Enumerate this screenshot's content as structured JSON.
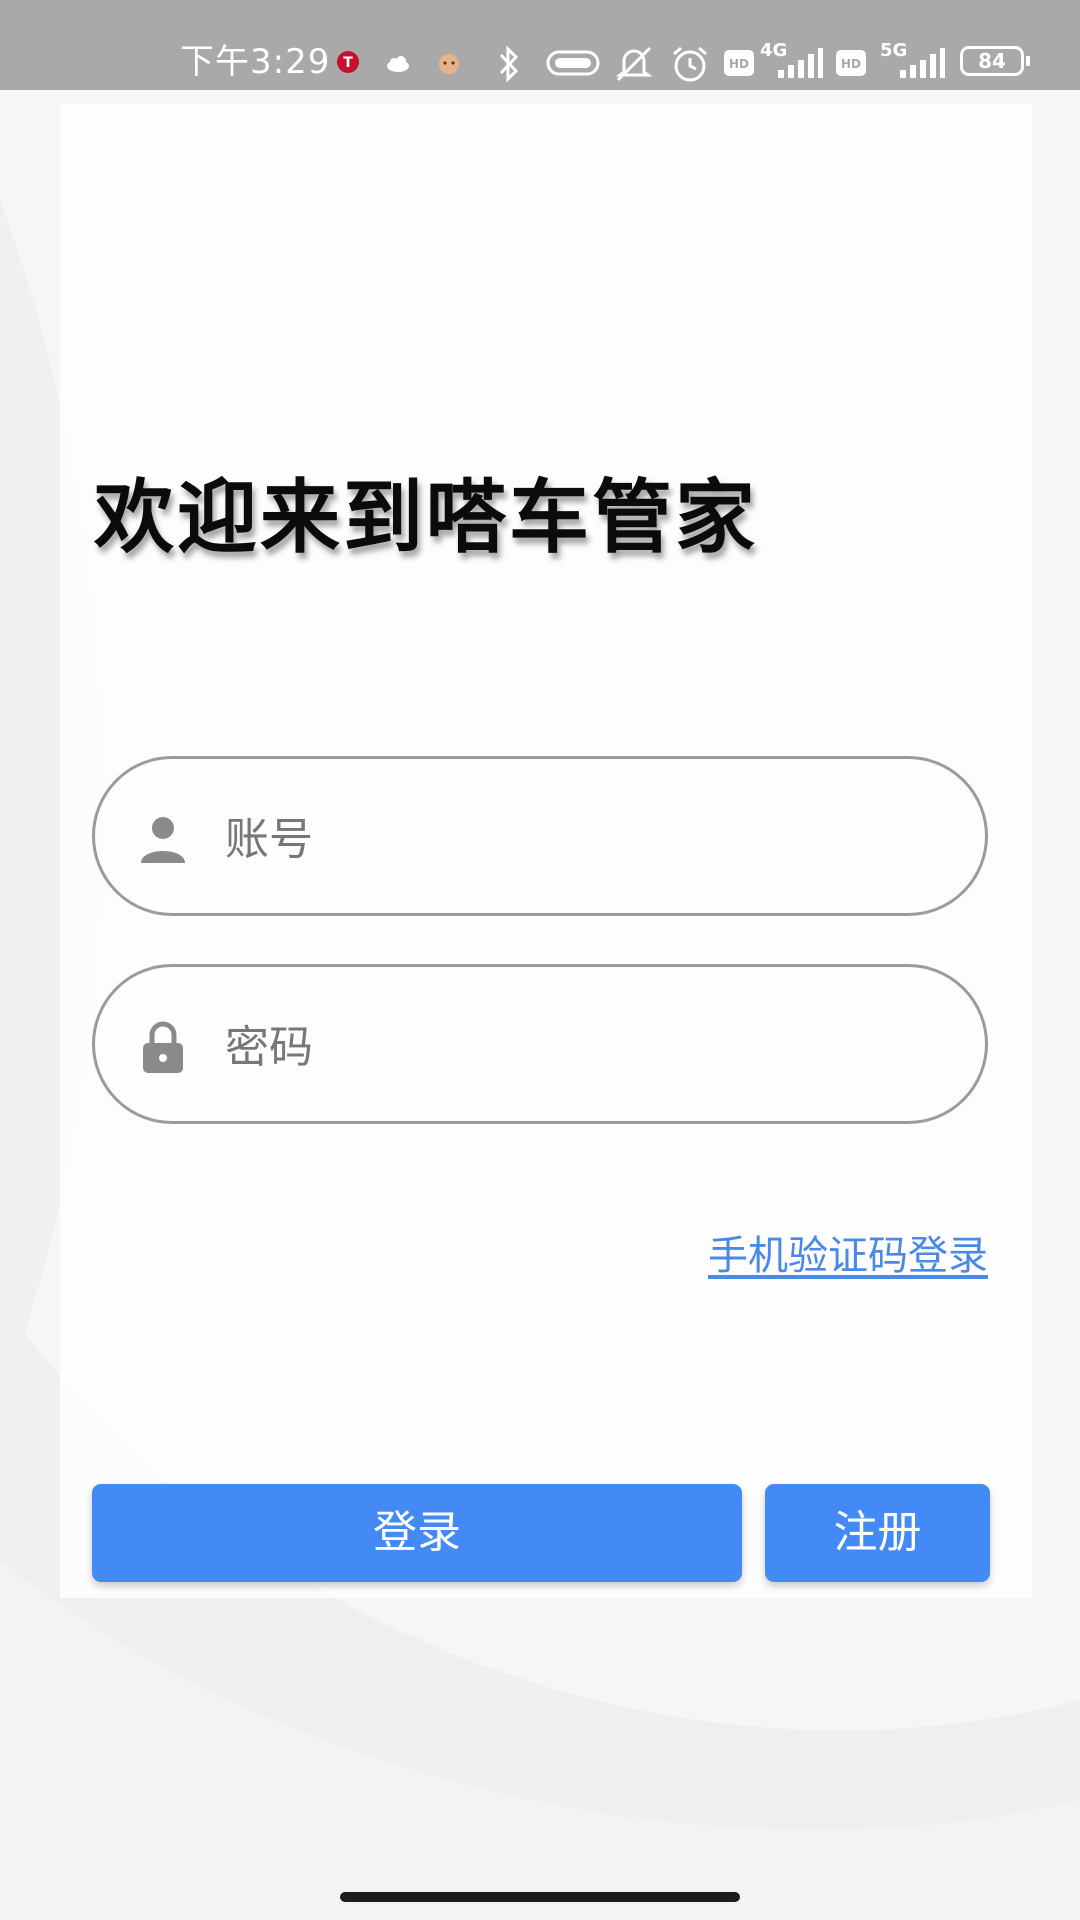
{
  "status_bar": {
    "time": "下午3:29",
    "battery": "84",
    "network_1": "4G",
    "network_2": "5G",
    "hd_label": "HD",
    "icons": [
      "taobao-app-icon",
      "cloud-app-icon",
      "cat-app-icon",
      "bluetooth-icon",
      "nfc-icon",
      "mute-icon",
      "alarm-icon",
      "hd-icon",
      "signal-icon",
      "battery-icon"
    ]
  },
  "login": {
    "title": "欢迎来到嗒车管家",
    "account_placeholder": "账号",
    "password_placeholder": "密码",
    "sms_login_link": "手机验证码登录",
    "login_button": "登录",
    "register_button": "注册"
  },
  "colors": {
    "primary": "#448af7",
    "link": "#4a8ae6",
    "status_bar": "#a9a9a9",
    "field_border": "#9b9b9b"
  }
}
